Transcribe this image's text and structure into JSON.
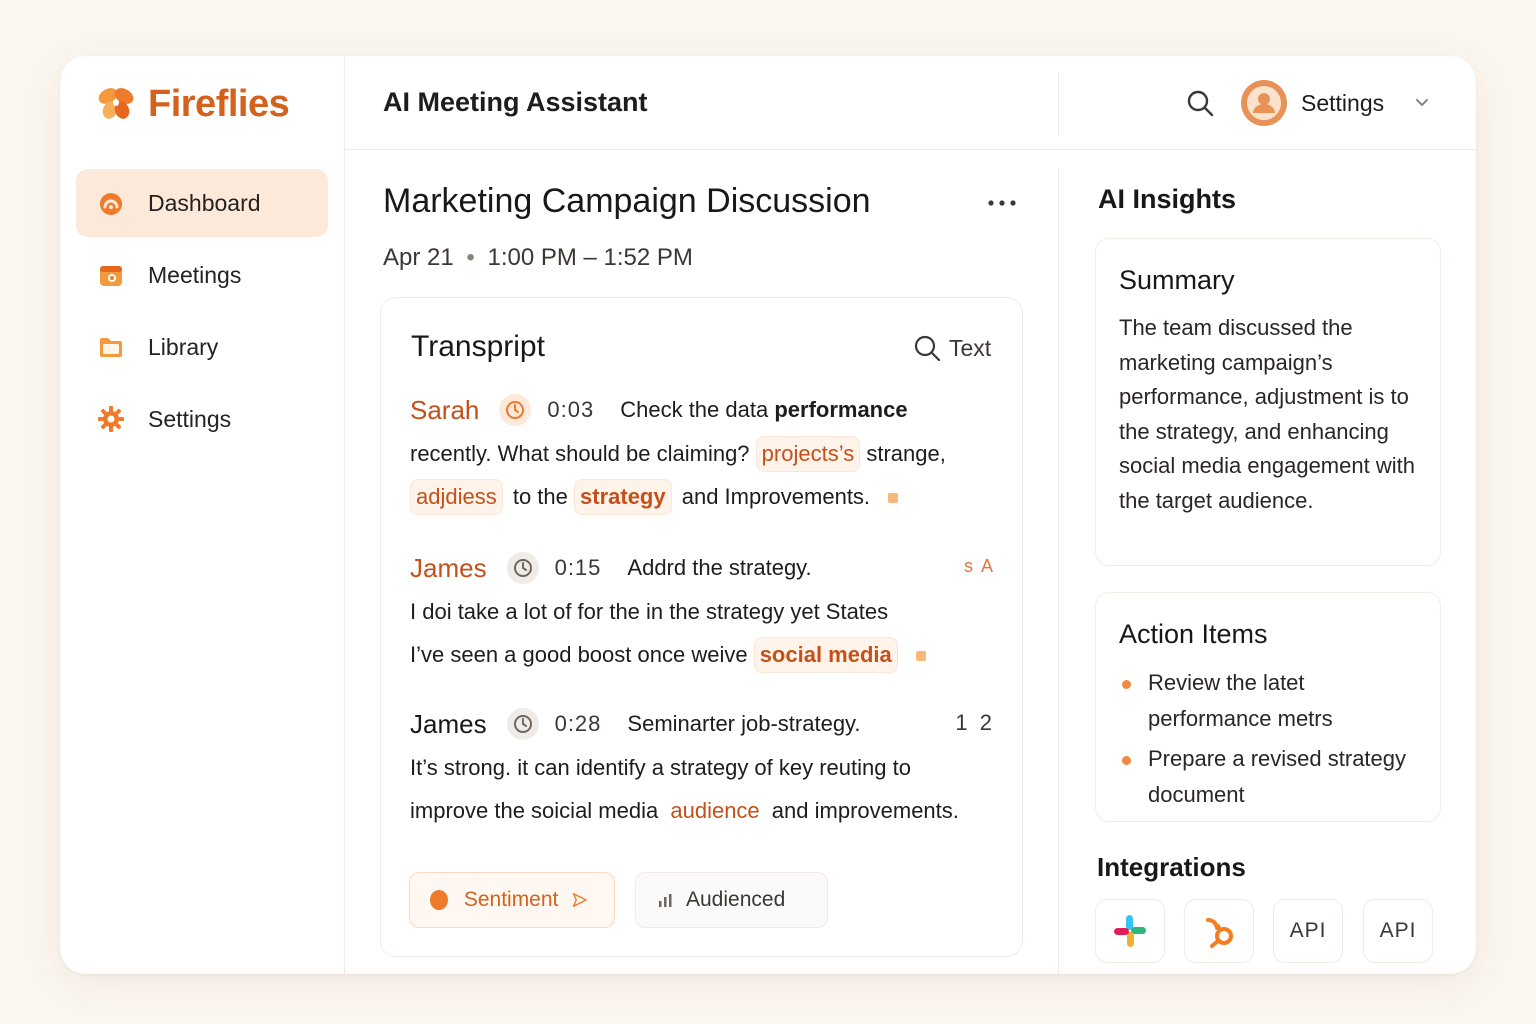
{
  "brand": {
    "name": "Fireflies",
    "accent": "#d4621c"
  },
  "sidebar": {
    "items": [
      {
        "label": "Dashboard",
        "icon": "dashboard-icon",
        "active": true
      },
      {
        "label": "Meetings",
        "icon": "meetings-icon",
        "active": false
      },
      {
        "label": "Library",
        "icon": "folder-icon",
        "active": false
      },
      {
        "label": "Settings",
        "icon": "gear-icon",
        "active": false
      }
    ]
  },
  "header": {
    "title": "AI Meeting Assistant",
    "settings_label": "Settings"
  },
  "meeting": {
    "title": "Marketing Campaign Discussion",
    "date": "Apr 21",
    "time_range": "1:00 PM – 1:52 PM"
  },
  "transcript": {
    "title": "Transpript",
    "search_placeholder": "Text",
    "entries": [
      {
        "speaker": "Sarah",
        "time": "0:03",
        "lead": "Check the data",
        "lead_bold": "performance",
        "line1_a": "recently. What should be claiming?",
        "line1_hl": "projects’s",
        "line1_b": "strange,",
        "line2_hl": "adjdiess",
        "line2_a": "to the",
        "line2_hl2": "strategy",
        "line2_b": "and Improvements."
      },
      {
        "speaker": "James",
        "time": "0:15",
        "lead": "Addrd the strategy.",
        "tag": "s A",
        "line1": "I doi take a lot of for the in the strategy yet States",
        "line2_a": "I’ve seen a good boost once weive",
        "line2_hl": "social media"
      },
      {
        "speaker": "James",
        "time": "0:28",
        "lead": "Seminarter job-strategy.",
        "num": "1 2",
        "line1": "It’s strong. it can identify a strategy of key reuting to",
        "line2_a": "improve the soicial media",
        "line2_hl": "audience",
        "line2_b": "and improvements."
      }
    ],
    "chips": {
      "sentiment": "Sentiment",
      "audience": "Audienced"
    }
  },
  "insights": {
    "title": "AI Insights",
    "summary": {
      "title": "Summary",
      "text": "The team discussed the marketing campaign’s performance, adjustment is to the strategy, and enhancing social media engagement with the target audience."
    },
    "actions": {
      "title": "Action Items",
      "items": [
        "Review the latet performance metrs",
        "Prepare a revised strategy document"
      ]
    },
    "integrations": {
      "title": "Integrations",
      "tiles": [
        "slack-icon",
        "hubspot-icon",
        "API",
        "API"
      ]
    }
  }
}
